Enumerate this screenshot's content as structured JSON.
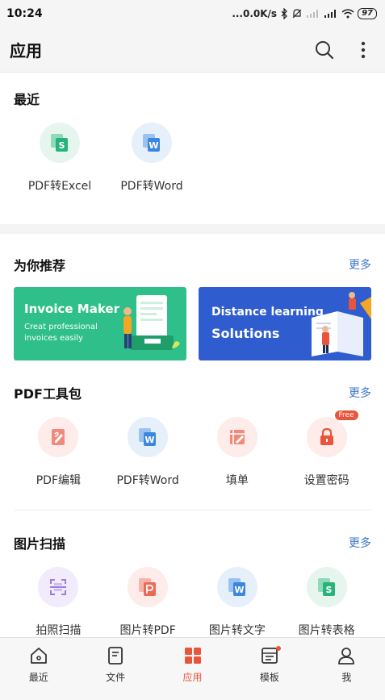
{
  "status_bar": {
    "time": "10:24",
    "network_speed": "...0.0K/s",
    "battery": "97"
  },
  "app_bar": {
    "title": "应用",
    "search_icon": "search-icon",
    "more_icon": "more-vertical-icon"
  },
  "recent": {
    "title": "最近",
    "items": [
      {
        "label": "PDF转Excel",
        "icon": "excel-icon"
      },
      {
        "label": "PDF转Word",
        "icon": "word-icon"
      }
    ]
  },
  "recommend": {
    "title": "为你推荐",
    "more": "更多",
    "banners": [
      {
        "title": "Invoice Maker",
        "subtitle_line1": "Creat professional",
        "subtitle_line2": "invoices easily"
      },
      {
        "title_line1": "Distance learning",
        "title_line2": "Solutions"
      }
    ]
  },
  "pdf_tools": {
    "title": "PDF工具包",
    "more": "更多",
    "items": [
      {
        "label": "PDF编辑",
        "icon": "pdf-edit-icon"
      },
      {
        "label": "PDF转Word",
        "icon": "word-icon"
      },
      {
        "label": "填单",
        "icon": "fill-form-icon"
      },
      {
        "label": "设置密码",
        "icon": "lock-icon",
        "badge": "Free"
      }
    ]
  },
  "image_scan": {
    "title": "图片扫描",
    "more": "更多",
    "items": [
      {
        "label": "拍照扫描",
        "icon": "scan-icon"
      },
      {
        "label": "图片转PDF",
        "icon": "pdf-icon"
      },
      {
        "label": "图片转文字",
        "icon": "word-icon"
      },
      {
        "label": "图片转表格",
        "icon": "excel-icon"
      }
    ]
  },
  "bottom_nav": {
    "items": [
      {
        "label": "最近",
        "icon": "home-icon"
      },
      {
        "label": "文件",
        "icon": "file-icon"
      },
      {
        "label": "应用",
        "icon": "apps-icon",
        "active": true
      },
      {
        "label": "模板",
        "icon": "template-icon"
      },
      {
        "label": "我",
        "icon": "profile-icon"
      }
    ]
  },
  "colors": {
    "accent": "#e9553b",
    "link": "#3d77c8",
    "banner_green": "#2fbf8a",
    "banner_blue": "#2f5ccf"
  }
}
